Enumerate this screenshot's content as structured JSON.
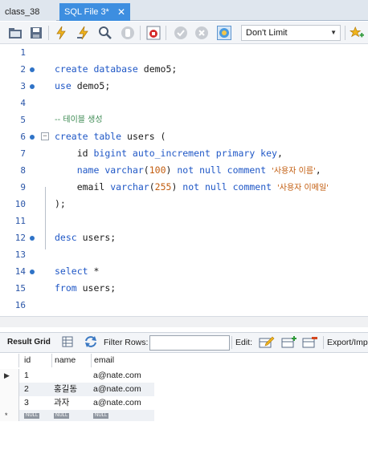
{
  "tabs": [
    {
      "label": "class_38",
      "active": false
    },
    {
      "label": "SQL File 3*",
      "active": true,
      "close": "✕"
    }
  ],
  "toolbar": {
    "limit_value": "Don't Limit",
    "icons": [
      "folder-open-icon",
      "save-icon",
      "execute-icon",
      "execute-line-icon",
      "explain-icon",
      "stop-icon",
      "toggle-error-icon",
      "commit-icon",
      "rollback-icon",
      "autocommit-icon",
      "add-snippet-icon"
    ]
  },
  "editor": {
    "lines": [
      {
        "n": "1"
      },
      {
        "n": "2"
      },
      {
        "n": "3"
      },
      {
        "n": "4"
      },
      {
        "n": "5"
      },
      {
        "n": "6"
      },
      {
        "n": "7"
      },
      {
        "n": "8"
      },
      {
        "n": "9"
      },
      {
        "n": "10"
      },
      {
        "n": "11"
      },
      {
        "n": "12"
      },
      {
        "n": "13"
      },
      {
        "n": "14"
      },
      {
        "n": "15"
      },
      {
        "n": "16"
      }
    ],
    "tokens": {
      "l2_kw": "create database",
      "l2_txt": " demo5;",
      "l3_kw": "use",
      "l3_txt": " demo5;",
      "l5_cm": "-- 테이블 생성",
      "l6_kw": "create table",
      "l6_txt": " users (",
      "l7_pre": "    id ",
      "l7_kw": "bigint auto_increment primary key",
      "l7_txt": ",",
      "l8_pre": "    ",
      "l8_kw1": "name varchar",
      "l8_p1": "(",
      "l8_num": "100",
      "l8_p2": ") ",
      "l8_kw2": "not null comment",
      "l8_sp": " ",
      "l8_str": "'사용자 이름'",
      "l8_end": ",",
      "l9_pre": "    email ",
      "l9_kw1": "varchar",
      "l9_p1": "(",
      "l9_num": "255",
      "l9_p2": ") ",
      "l9_kw2": "not null comment",
      "l9_sp": " ",
      "l9_str": "'사용자 이메일'",
      "l10_txt": ");",
      "l12_kw": "desc",
      "l12_txt": " users;",
      "l14_kw": "select",
      "l14_txt": " *",
      "l15_kw": "from",
      "l15_txt": " users;"
    }
  },
  "result_toolbar": {
    "result_grid": "Result Grid",
    "filter_rows": "Filter Rows:",
    "edit": "Edit:",
    "export": "Export/Imp"
  },
  "grid": {
    "columns": [
      "id",
      "name",
      "email"
    ],
    "rows": [
      {
        "id": "1",
        "name": "",
        "email": "a@nate.com"
      },
      {
        "id": "2",
        "name": "홍길동",
        "email": "a@nate.com"
      },
      {
        "id": "3",
        "name": "과자",
        "email": "a@nate.com"
      }
    ],
    "null_label": "NULL"
  }
}
